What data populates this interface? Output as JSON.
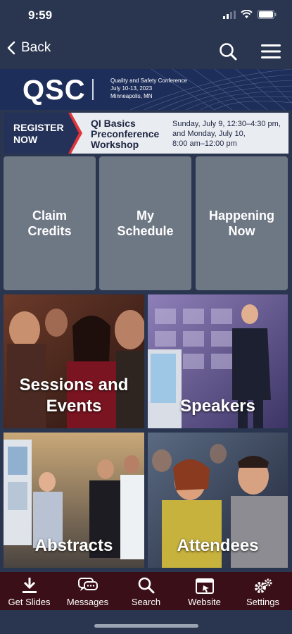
{
  "status": {
    "time": "9:59"
  },
  "nav": {
    "back_label": "Back"
  },
  "banner": {
    "logo": "QSC",
    "line1": "Quality and Safety Conference",
    "line2": "July 10-13, 2023",
    "line3": "Minneapolis, MN"
  },
  "register": {
    "button_line1": "REGISTER",
    "button_line2": "NOW",
    "title_line1": "QI Basics",
    "title_line2": "Preconference",
    "title_line3": "Workshop",
    "date_line1": "Sunday, July 9, 12:30–4:30 pm,",
    "date_line2": "and Monday, July 10,",
    "date_line3": "8:00 am–12:00 pm"
  },
  "tiles": [
    {
      "line1": "Claim",
      "line2": "Credits"
    },
    {
      "line1": "My",
      "line2": "Schedule"
    },
    {
      "line1": "Happening",
      "line2": "Now"
    }
  ],
  "photos": {
    "sessions": {
      "line1": "Sessions and",
      "line2": "Events"
    },
    "speakers": "Speakers",
    "abstracts": "Abstracts",
    "attendees": "Attendees"
  },
  "tabbar": [
    {
      "label": "Get Slides",
      "icon": "download-icon"
    },
    {
      "label": "Messages",
      "icon": "chat-icon"
    },
    {
      "label": "Search",
      "icon": "search-icon"
    },
    {
      "label": "Website",
      "icon": "browser-icon"
    },
    {
      "label": "Settings",
      "icon": "gear-icon"
    }
  ],
  "colors": {
    "nav_bg": "#2a3550",
    "tile_bg": "#6e7784",
    "tabbar_bg": "#3a0f17",
    "register_accent": "#e0343a"
  }
}
